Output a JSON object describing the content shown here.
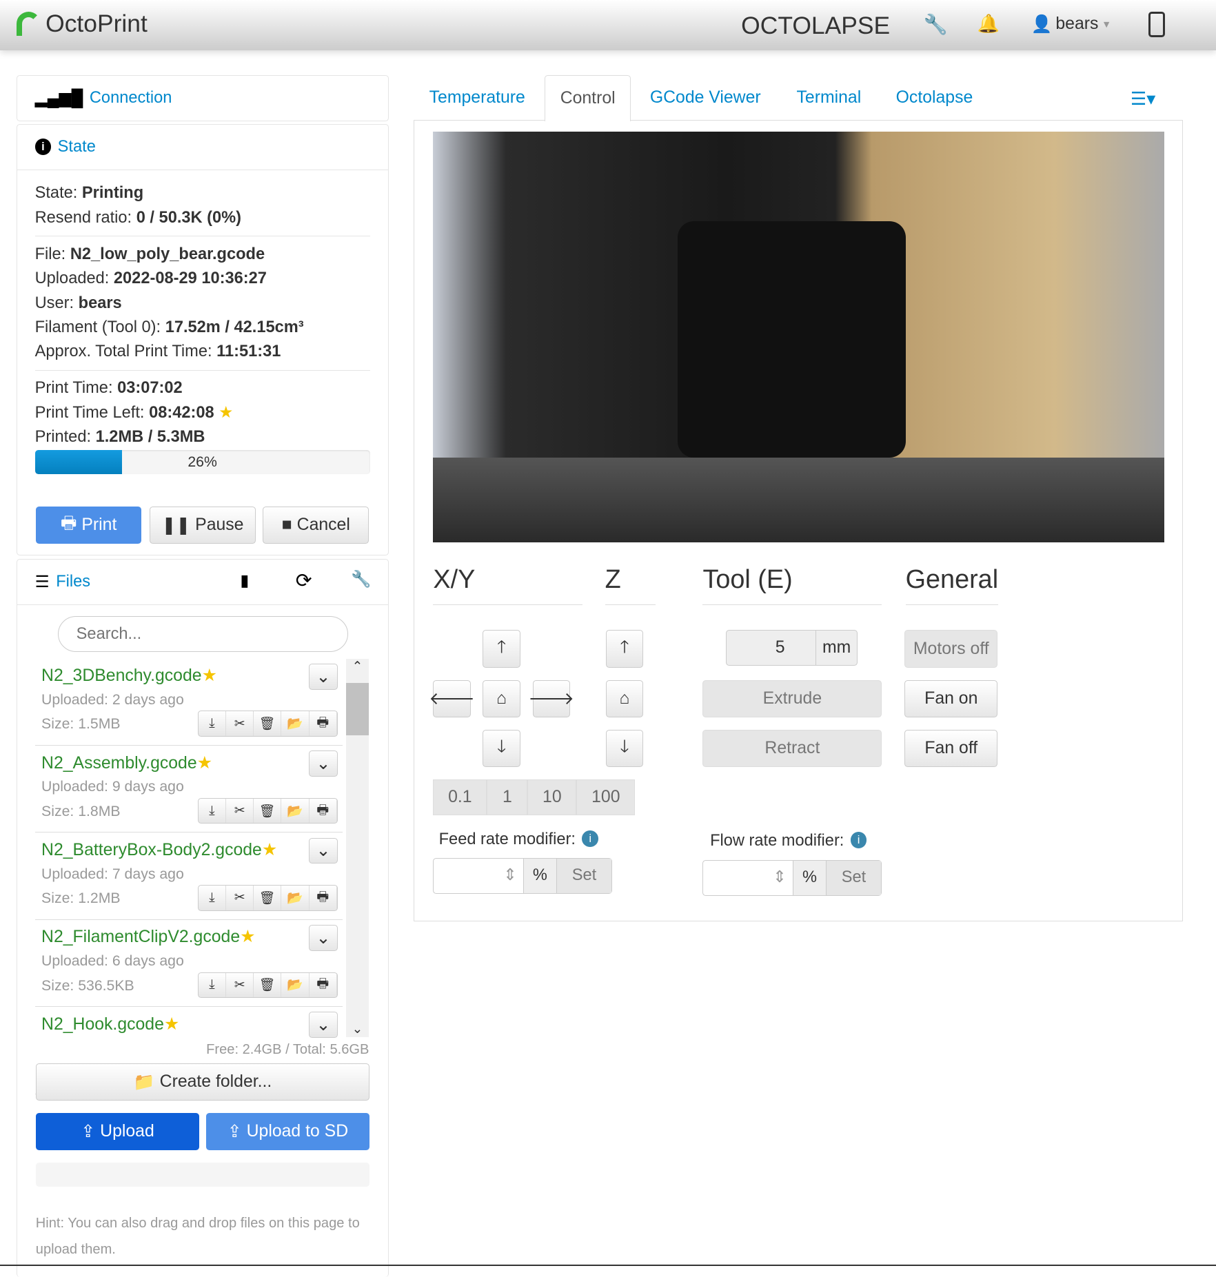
{
  "navbar": {
    "brand": "OctoPrint",
    "plugin_logo": "OCTOLAPSE",
    "user": "bears",
    "icons": [
      "wrench-icon",
      "bell-icon",
      "user-icon",
      "mobile-icon"
    ]
  },
  "connection": {
    "title": "Connection"
  },
  "state": {
    "title": "State",
    "state_label": "State:",
    "state": "Printing",
    "resend_label": "Resend ratio:",
    "resend": "0 / 50.3K (0%)",
    "file_label": "File:",
    "file": "N2_low_poly_bear.gcode",
    "uploaded_label": "Uploaded:",
    "uploaded": "2022-08-29 10:36:27",
    "user_label": "User:",
    "user": "bears",
    "filament_label": "Filament (Tool 0):",
    "filament": "17.52m / 42.15cm³",
    "approx_label": "Approx. Total Print Time:",
    "approx": "11:51:31",
    "print_time_label": "Print Time:",
    "print_time": "03:07:02",
    "left_label": "Print Time Left:",
    "left": "08:42:08",
    "printed_label": "Printed:",
    "printed": "1.2MB / 5.3MB",
    "progress_percent": 26,
    "progress_text": "26%",
    "print_btn": "Print",
    "pause_btn": "Pause",
    "cancel_btn": "Cancel"
  },
  "files": {
    "title": "Files",
    "search_placeholder": "Search...",
    "items": [
      {
        "name": "N2_3DBenchy.gcode",
        "uploaded": "Uploaded: 2 days ago",
        "size": "Size: 1.5MB"
      },
      {
        "name": "N2_Assembly.gcode",
        "uploaded": "Uploaded: 9 days ago",
        "size": "Size: 1.8MB"
      },
      {
        "name": "N2_BatteryBox-Body2.gcode",
        "uploaded": "Uploaded: 7 days ago",
        "size": "Size: 1.2MB"
      },
      {
        "name": "N2_FilamentClipV2.gcode",
        "uploaded": "Uploaded: 6 days ago",
        "size": "Size: 536.5KB"
      },
      {
        "name": "N2_Hook.gcode"
      }
    ],
    "free": "Free: 2.4GB / Total: 5.6GB",
    "create_folder": "Create folder...",
    "upload": "Upload",
    "upload_sd": "Upload to SD",
    "hint": "Hint: You can also drag and drop files on this page to upload them."
  },
  "tabs": [
    "Temperature",
    "Control",
    "GCode Viewer",
    "Terminal",
    "Octolapse"
  ],
  "active_tab": "Control",
  "control": {
    "xy": "X/Y",
    "z": "Z",
    "tool": "Tool (E)",
    "general": "General",
    "steps": [
      "0.1",
      "1",
      "10",
      "100"
    ],
    "tool_amount": "5",
    "tool_unit": "mm",
    "extrude": "Extrude",
    "retract": "Retract",
    "motors_off": "Motors off",
    "fan_on": "Fan on",
    "fan_off": "Fan off",
    "feed_label": "Feed rate modifier:",
    "flow_label": "Flow rate modifier:",
    "percent": "%",
    "set": "Set"
  },
  "colors": {
    "link": "#0088cc",
    "progress": "#0e90d2",
    "file_name": "#2e8b2e",
    "star": "#f5c400",
    "primary": "#0e5fd8"
  }
}
